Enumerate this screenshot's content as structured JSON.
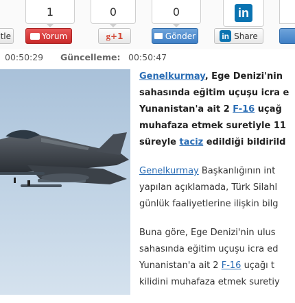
{
  "share_bar": {
    "tweet": {
      "label": "tle"
    },
    "yorum": {
      "count": "1",
      "label": "Yorum"
    },
    "gplus": {
      "count": "0",
      "label": "+1"
    },
    "gonder": {
      "count": "0",
      "label": "Gönder"
    },
    "linkedin": {
      "label": "Share",
      "logo": "in"
    },
    "extra": {
      "label": ""
    }
  },
  "meta": {
    "published_time": "00:50:29",
    "updated_label": "Güncelleme:",
    "updated_time": "00:50:47"
  },
  "article": {
    "p1": {
      "link_genelkurmay": "Genelkurmay",
      "l1_rest": ", Ege Denizi'nin",
      "l2": "sahasında eğitim uçuşu icra e",
      "l3_pre": "Yunanistan'a ait 2 ",
      "link_f16": "F-16",
      "l3_post": " uçağ",
      "l4": "muhafaza etmek suretiyle 11",
      "l5_pre": "süreyle ",
      "link_taciz": "taciz",
      "l5_post": " edildiği bildirild"
    },
    "p2": {
      "link_genelkurmay": "Genelkurmay",
      "l1_rest": " Başkanlığının int",
      "l2": "yapılan açıklamada, Türk Silahl",
      "l3": "günlük faaliyetlerine ilişkin bilg"
    },
    "p3": {
      "l1": "Buna göre, Ege Denizi'nin ulus",
      "l2": "sahasında eğitim uçuşu icra ed",
      "l3_pre": "Yunanistan'a ait 2 ",
      "link_f16": "F-16",
      "l3_post": " uçağı t",
      "l4": "kilidini muhafaza etmek suretiy"
    }
  },
  "colors": {
    "link": "#2a6db5",
    "yorum_red": "#c92a2a",
    "linkedin_blue": "#0a73b1",
    "gplus_red": "#d34836"
  }
}
